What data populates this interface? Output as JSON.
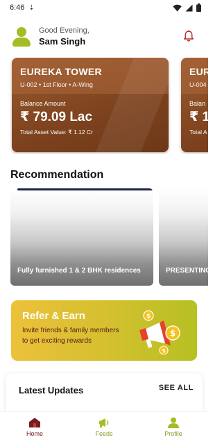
{
  "status_bar": {
    "time": "6:46"
  },
  "header": {
    "greeting": "Good Evening,",
    "user_name": "Sam Singh"
  },
  "asset_cards": [
    {
      "title": "EUREKA TOWER",
      "unit": "U-002 • 1st Floor • A-Wing",
      "balance_label": "Balance Amount",
      "balance": "₹ 79.09 Lac",
      "total": "Total Asset Value: ₹ 1.12 Cr"
    },
    {
      "title": "EURE",
      "unit": "U-004 •",
      "balance_label": "Balan",
      "balance": "₹ 1.",
      "total": "Total A"
    }
  ],
  "recommendation": {
    "title": "Recommendation",
    "items": [
      {
        "caption": "Fully furnished 1 & 2 BHK residences"
      },
      {
        "caption": "PRESENTING"
      }
    ]
  },
  "refer": {
    "title": "Refer & Earn",
    "description": "Invite friends & family members to get exciting rewards"
  },
  "updates": {
    "title": "Latest Updates",
    "see_all": "SEE ALL"
  },
  "bottom_nav": {
    "items": [
      {
        "label": "Home",
        "icon": "home-icon",
        "active": true
      },
      {
        "label": "Feeds",
        "icon": "megaphone-icon",
        "active": false
      },
      {
        "label": "Profile",
        "icon": "profile-icon",
        "active": false
      }
    ]
  },
  "colors": {
    "brand_green": "#a3bd25",
    "card_brown": "#7e431f",
    "active_nav": "#7a1c1c",
    "bell_red": "#c0262a"
  }
}
